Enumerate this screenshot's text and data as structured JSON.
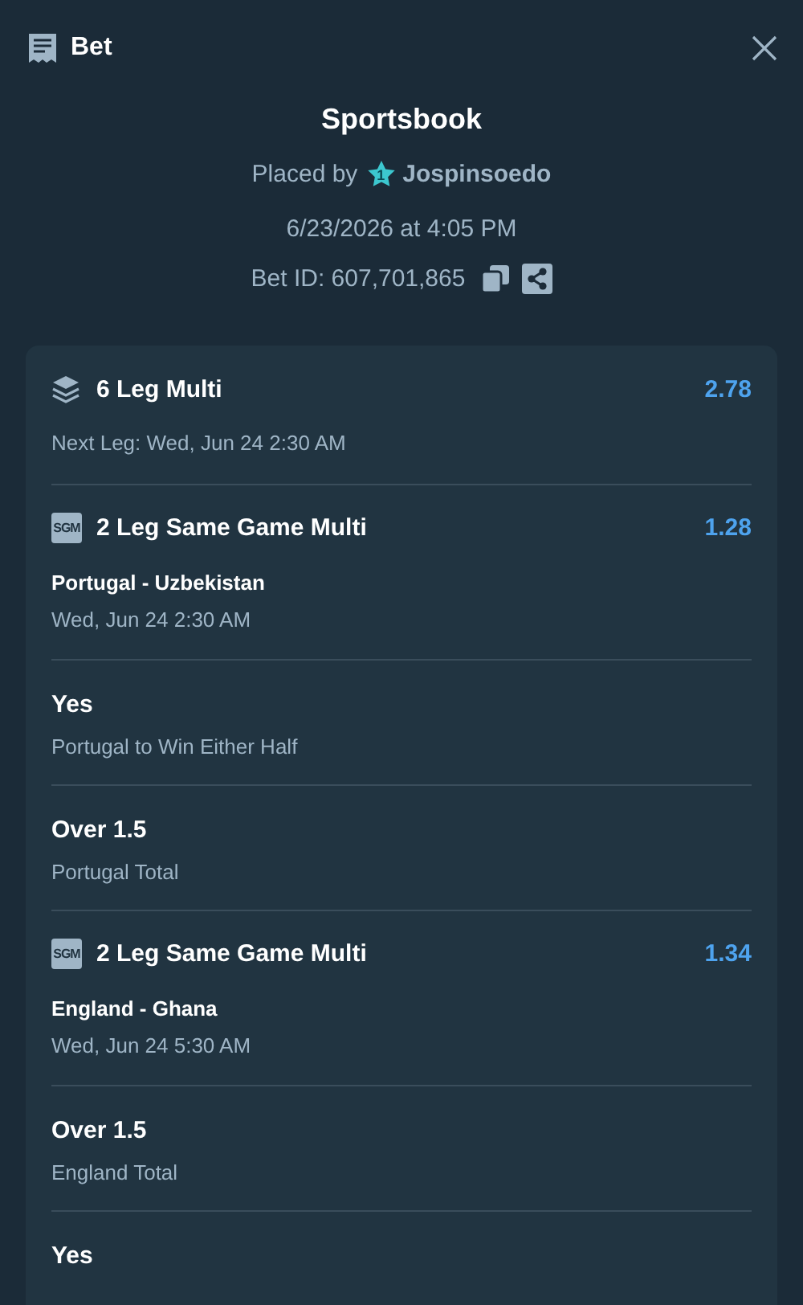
{
  "header": {
    "title": "Bet"
  },
  "summary": {
    "title": "Sportsbook",
    "placed_by_label": "Placed by",
    "user": "Jospinsoedo",
    "rank_badge": "1",
    "date": "6/23/2026 at 4:05 PM",
    "bet_id": "Bet ID: 607,701,865"
  },
  "legs": [
    {
      "kind": "multi",
      "title": "6 Leg Multi",
      "odds": "2.78",
      "subtitle": "Next Leg: Wed, Jun 24 2:30 AM"
    },
    {
      "kind": "sgm",
      "badge": "SGM",
      "title": "2 Leg Same Game Multi",
      "odds": "1.28",
      "match": "Portugal - Uzbekistan",
      "time": "Wed, Jun 24 2:30 AM"
    },
    {
      "kind": "selection",
      "title": "Yes",
      "subtitle": "Portugal to Win Either Half"
    },
    {
      "kind": "selection",
      "title": "Over 1.5",
      "subtitle": "Portugal Total"
    },
    {
      "kind": "sgm",
      "badge": "SGM",
      "title": "2 Leg Same Game Multi",
      "odds": "1.34",
      "match": "England - Ghana",
      "time": "Wed, Jun 24 5:30 AM"
    },
    {
      "kind": "selection",
      "title": "Over 1.5",
      "subtitle": "England Total"
    },
    {
      "kind": "selection",
      "title": "Yes"
    }
  ]
}
